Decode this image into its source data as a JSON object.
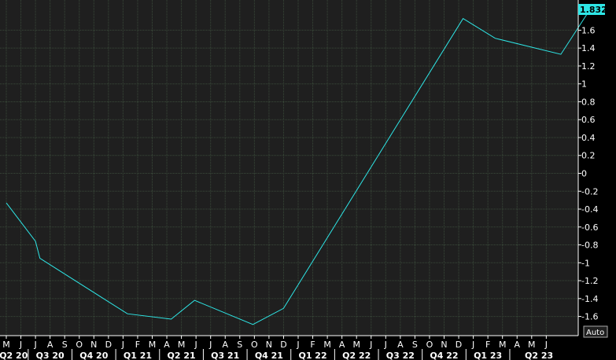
{
  "chart_data": {
    "type": "line",
    "x": [
      "May 20",
      "Jul 20",
      "Aug 20",
      "Sep 20",
      "Oct 20",
      "Nov 20",
      "Dec 20",
      "Jan 21",
      "Feb 21",
      "Mar 21",
      "Apr 21",
      "May 21",
      "Jun 21",
      "Jul 21",
      "Aug 21",
      "Sep 21",
      "Oct 21",
      "Nov 21",
      "Dec 21",
      "Jan 22",
      "Feb 22",
      "Mar 22",
      "Apr 22",
      "May 22",
      "Jun 22",
      "Jul 22",
      "Aug 22",
      "Sep 22",
      "Oct 22",
      "Nov 22",
      "Dec 22",
      "Jan 23",
      "Feb 23",
      "Mar 23",
      "Apr 23",
      "May 23",
      "Jun 23"
    ],
    "series": [
      {
        "color": "#2ee6e6",
        "points": [
          {
            "m": 0,
            "v": -0.33
          },
          {
            "m": 2,
            "v": -0.76
          },
          {
            "m": 2.3,
            "v": -0.95
          },
          {
            "m": 8.3,
            "v": -1.57
          },
          {
            "m": 11.3,
            "v": -1.63
          },
          {
            "m": 12.9,
            "v": -1.42
          },
          {
            "m": 16.9,
            "v": -1.69
          },
          {
            "m": 19.0,
            "v": -1.51
          },
          {
            "m": 31.3,
            "v": 1.73
          },
          {
            "m": 33.5,
            "v": 1.51
          },
          {
            "m": 38.0,
            "v": 1.33
          },
          {
            "m": 40.0,
            "v": 1.832
          }
        ]
      }
    ],
    "last_value_label": "1.832",
    "y_ticks": [
      "1.6",
      "1.4",
      "1.2",
      "1",
      "0.8",
      "0.6",
      "0.4",
      "0.2",
      "0",
      "-0.2",
      "-0.4",
      "-0.6",
      "-0.8",
      "-1",
      "-1.2",
      "-1.4",
      "-1.6"
    ],
    "ylim": [
      -1.8,
      1.85
    ],
    "month_labels": [
      {
        "m": 0,
        "text": "M"
      },
      {
        "m": 1,
        "text": "J"
      },
      {
        "m": 2,
        "text": "J"
      },
      {
        "m": 3,
        "text": "A"
      },
      {
        "m": 4,
        "text": "S"
      },
      {
        "m": 5,
        "text": "O"
      },
      {
        "m": 6,
        "text": "N"
      },
      {
        "m": 7,
        "text": "D"
      },
      {
        "m": 8,
        "text": "J"
      },
      {
        "m": 9,
        "text": "F"
      },
      {
        "m": 10,
        "text": "M"
      },
      {
        "m": 11,
        "text": "A"
      },
      {
        "m": 12,
        "text": "M"
      },
      {
        "m": 13,
        "text": "J"
      },
      {
        "m": 14,
        "text": "J"
      },
      {
        "m": 15,
        "text": "A"
      },
      {
        "m": 16,
        "text": "S"
      },
      {
        "m": 17,
        "text": "O"
      },
      {
        "m": 18,
        "text": "N"
      },
      {
        "m": 19,
        "text": "D"
      },
      {
        "m": 20,
        "text": "J"
      },
      {
        "m": 21,
        "text": "F"
      },
      {
        "m": 22,
        "text": "M"
      },
      {
        "m": 23,
        "text": "A"
      },
      {
        "m": 24,
        "text": "M"
      },
      {
        "m": 25,
        "text": "J"
      },
      {
        "m": 26,
        "text": "J"
      },
      {
        "m": 27,
        "text": "A"
      },
      {
        "m": 28,
        "text": "S"
      },
      {
        "m": 29,
        "text": "O"
      },
      {
        "m": 30,
        "text": "N"
      },
      {
        "m": 31,
        "text": "D"
      },
      {
        "m": 32,
        "text": "J"
      },
      {
        "m": 33,
        "text": "F"
      },
      {
        "m": 34,
        "text": "M"
      },
      {
        "m": 35,
        "text": "A"
      },
      {
        "m": 36,
        "text": "M"
      },
      {
        "m": 37,
        "text": "J"
      }
    ],
    "quarter_labels": [
      {
        "m": 0.5,
        "text": "Q2 20"
      },
      {
        "m": 3,
        "text": "Q3 20"
      },
      {
        "m": 6,
        "text": "Q4 20"
      },
      {
        "m": 9,
        "text": "Q1 21"
      },
      {
        "m": 12,
        "text": "Q2 21"
      },
      {
        "m": 15,
        "text": "Q3 21"
      },
      {
        "m": 18,
        "text": "Q4 21"
      },
      {
        "m": 21,
        "text": "Q1 22"
      },
      {
        "m": 24,
        "text": "Q2 22"
      },
      {
        "m": 27,
        "text": "Q3 22"
      },
      {
        "m": 30,
        "text": "Q4 22"
      },
      {
        "m": 33,
        "text": "Q1 23"
      },
      {
        "m": 36.5,
        "text": "Q2 23"
      }
    ],
    "grid": true,
    "scale_mode_label": "Auto",
    "colors": {
      "background": "#1f1f1f",
      "grid": "#3a4a3a",
      "line": "#2ee6e6",
      "text": "#ffffff",
      "label_bg": "#2ee6e6"
    }
  }
}
